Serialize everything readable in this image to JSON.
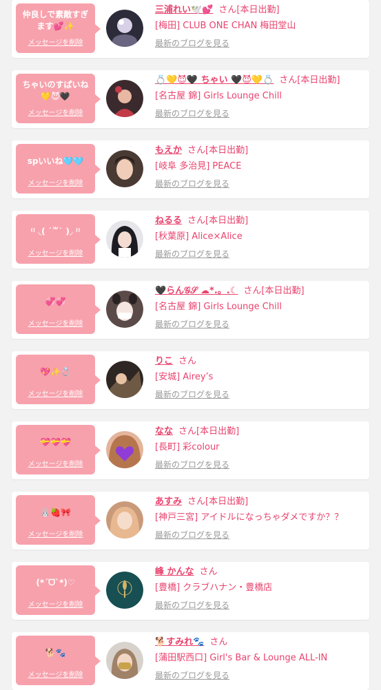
{
  "colors": {
    "accent": "#e8436d",
    "bubble": "#f7a1ac",
    "muted": "#9a9a9a",
    "background": "#f2f2f2"
  },
  "items": [
    {
      "message": "仲良しで素敵すぎます💕✨",
      "delete_label": "メッセージを削除",
      "name": "三浦れい🕊️💕",
      "san": "さん",
      "status": "[本日出勤]",
      "shop": "[梅田] CLUB ONE CHAN 梅田堂山",
      "blog_label": "最新のブログを見る"
    },
    {
      "message": "ちゃいのすぱいね💛😈🖤",
      "delete_label": "メッセージを削除",
      "name": "💍💛😈🖤 ちゃい 🖤😈💛💍",
      "san": "さん",
      "status": "[本日出勤]",
      "shop": "[名古屋 錦] Girls Lounge Chill",
      "blog_label": "最新のブログを見る"
    },
    {
      "message": "spいいね🩵🩵",
      "delete_label": "メッセージを削除",
      "name": "もえか",
      "san": "さん",
      "status": "[本日出勤]",
      "shop": "[岐阜 多治見] PEACE",
      "blog_label": "最新のブログを見る"
    },
    {
      "message": "⁽⁽ ◟( ˙꒳˙ )◞ ⁾⁾",
      "delete_label": "メッセージを削除",
      "name": "ねるる",
      "san": "さん",
      "status": "[本日出勤]",
      "shop": "[秋葉原] Alice×Alice",
      "blog_label": "最新のブログを見る"
    },
    {
      "message": "💞💞",
      "delete_label": "メッセージを削除",
      "name": "🖤らん𝒢𝒮 ☁︎*.。.☾",
      "san": "さん",
      "status": "[本日出勤]",
      "shop": "[名古屋 錦] Girls Lounge Chill",
      "blog_label": "最新のブログを見る"
    },
    {
      "message": "💖✨💍",
      "delete_label": "メッセージを削除",
      "name": "りこ",
      "san": "さん",
      "status": "",
      "shop": "[安城] Airey’s",
      "blog_label": "最新のブログを見る"
    },
    {
      "message": "💝💝💝",
      "delete_label": "メッセージを削除",
      "name": "なな",
      "san": "さん",
      "status": "[本日出勤]",
      "shop": "[長町] 彩colour",
      "blog_label": "最新のブログを見る"
    },
    {
      "message": "🐰🍓🎀",
      "delete_label": "メッセージを削除",
      "name": "あすみ",
      "san": "さん",
      "status": "[本日出勤]",
      "shop": "[神戸三宮] アイドルになっちゃダメですか？？",
      "blog_label": "最新のブログを見る"
    },
    {
      "message": "(*ˊᗜˋ*)♡",
      "delete_label": "メッセージを削除",
      "name": "峰 かんな",
      "san": "さん",
      "status": "",
      "shop": "[豊橋] クラブハナン・豊橋店",
      "blog_label": "最新のブログを見る"
    },
    {
      "message": "🐕🐾",
      "delete_label": "メッセージを削除",
      "name": "🐕すみれ🐾",
      "san": "さん",
      "status": "",
      "shop": "[蒲田駅西口] Girl's Bar & Lounge ALL-IN",
      "blog_label": "最新のブログを見る"
    }
  ]
}
